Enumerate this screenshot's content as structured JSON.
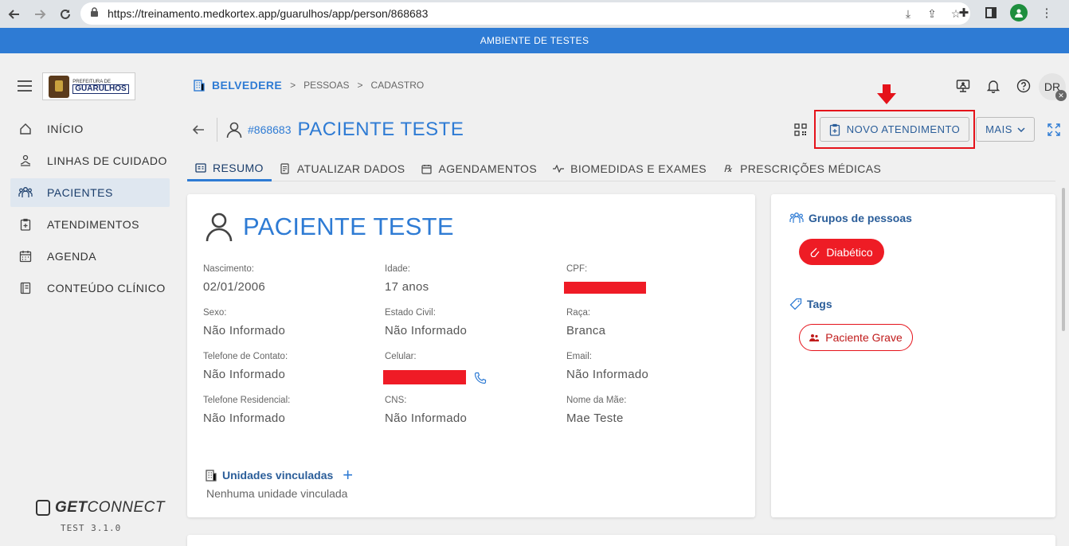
{
  "browser": {
    "url": "https://treinamento.medkortex.app/guarulhos/app/person/868683"
  },
  "banner": "AMBIENTE DE TESTES",
  "sidebar": {
    "logo_line1": "PREFEITURA DE",
    "logo_line2": "GUARULHOS",
    "items": [
      {
        "label": "INÍCIO",
        "icon": "home-icon"
      },
      {
        "label": "LINHAS DE CUIDADO",
        "icon": "care-lines-icon"
      },
      {
        "label": "PACIENTES",
        "icon": "patients-icon",
        "active": true
      },
      {
        "label": "ATENDIMENTOS",
        "icon": "clipboard-icon"
      },
      {
        "label": "AGENDA",
        "icon": "calendar-icon"
      },
      {
        "label": "CONTEÚDO CLÍNICO",
        "icon": "book-icon"
      }
    ],
    "brand_bold": "GET",
    "brand_rest": "CONNECT",
    "version": "TEST 3.1.0"
  },
  "breadcrumb": {
    "root": "BELVEDERE",
    "items": [
      "PESSOAS",
      "CADASTRO"
    ],
    "sep": ">"
  },
  "user": {
    "initials": "DR"
  },
  "patient": {
    "id": "#868683",
    "name": "PACIENTE TESTE"
  },
  "actions": {
    "novo_atendimento": "NOVO ATENDIMENTO",
    "mais": "MAIS"
  },
  "tabs": [
    {
      "label": "RESUMO",
      "active": true
    },
    {
      "label": "ATUALIZAR DADOS"
    },
    {
      "label": "AGENDAMENTOS"
    },
    {
      "label": "BIOMEDIDAS E EXAMES"
    },
    {
      "label": "PRESCRIÇÕES MÉDICAS"
    }
  ],
  "details": {
    "nascimento": {
      "label": "Nascimento:",
      "value": "02/01/2006"
    },
    "idade": {
      "label": "Idade:",
      "value": "17 anos"
    },
    "cpf": {
      "label": "CPF:",
      "value": ""
    },
    "sexo": {
      "label": "Sexo:",
      "value": "Não Informado"
    },
    "estado_civil": {
      "label": "Estado Civil:",
      "value": "Não Informado"
    },
    "raca": {
      "label": "Raça:",
      "value": "Branca"
    },
    "telefone_contato": {
      "label": "Telefone de Contato:",
      "value": "Não Informado"
    },
    "celular": {
      "label": "Celular:",
      "value": ""
    },
    "email": {
      "label": "Email:",
      "value": "Não Informado"
    },
    "telefone_residencial": {
      "label": "Telefone Residencial:",
      "value": "Não Informado"
    },
    "cns": {
      "label": "CNS:",
      "value": "Não Informado"
    },
    "nome_mae": {
      "label": "Nome da Mãe:",
      "value": "Mae Teste"
    }
  },
  "unidades": {
    "title": "Unidades vinculadas",
    "empty": "Nenhuma unidade vinculada"
  },
  "side": {
    "grupos_title": "Grupos de pessoas",
    "grupo_chip": "Diabético",
    "tags_title": "Tags",
    "tag_chip": "Paciente Grave"
  },
  "colors": {
    "accent": "#2e7bd4",
    "banner": "#2e7bd4",
    "danger": "#ee1c25",
    "highlight": "#e5121a"
  }
}
